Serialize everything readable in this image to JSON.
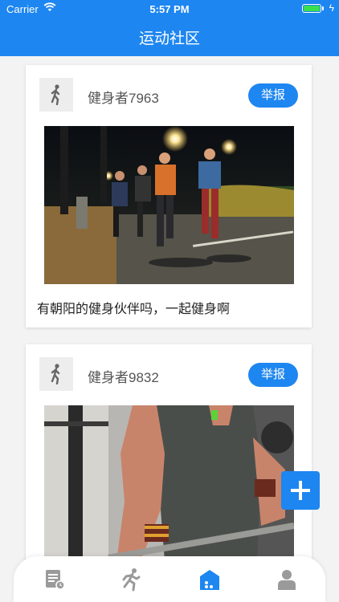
{
  "status": {
    "carrier": "Carrier",
    "time": "5:57 PM"
  },
  "nav": {
    "title": "运动社区"
  },
  "posts": [
    {
      "username": "健身者7963",
      "report_label": "举报",
      "caption": "有朝阳的健身伙伴吗，一起健身啊"
    },
    {
      "username": "健身者9832",
      "report_label": "举报"
    }
  ],
  "tabbar": {
    "icons": [
      "list-icon",
      "runner-icon",
      "community-icon",
      "profile-icon"
    ],
    "active_index": 2
  },
  "colors": {
    "primary": "#1e86f0",
    "inactive_icon": "#9a9a9a",
    "background": "#f3f3f3"
  }
}
